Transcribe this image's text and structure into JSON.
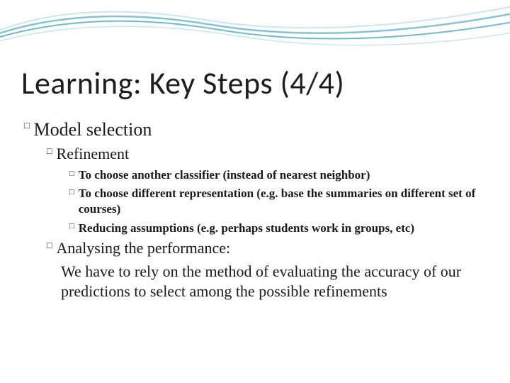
{
  "slide": {
    "title": "Learning: Key Steps (4/4)",
    "l1_a": "Model selection",
    "l2_a": "Refinement",
    "l3_a": "To choose another classifier (instead of nearest neighbor)",
    "l3_b": "To choose different representation (e.g. base the summaries on different set of courses)",
    "l3_c": "Reducing assumptions (e.g. perhaps students work in groups, etc)",
    "l2_b": "Analysing the performance:",
    "l2_b_body": "We have to rely on the method of evaluating the accuracy of our predictions to select among the possible refinements"
  }
}
